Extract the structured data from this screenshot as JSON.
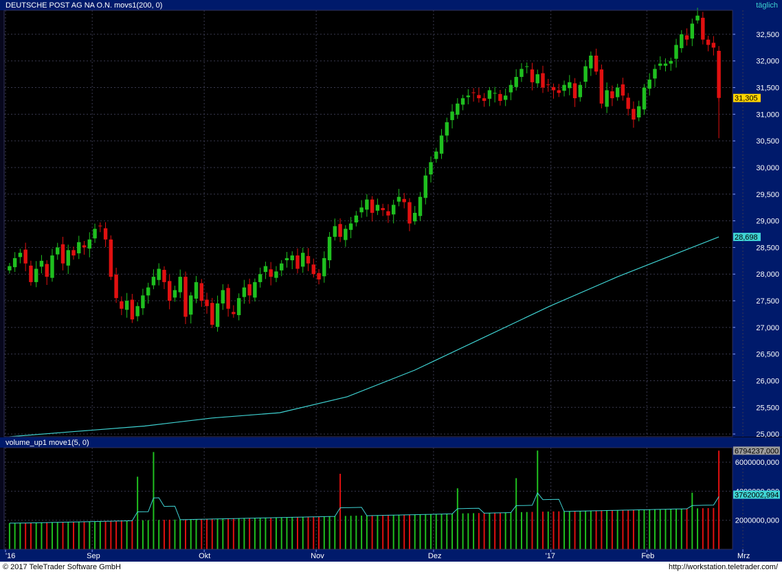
{
  "header": {
    "instrument": "DEUTSCHE POST AG NA O.N.",
    "indicator": "movs1(200, 0)",
    "period": "täglich"
  },
  "volume_header": "volume_up1 move1(5, 0)",
  "footer": {
    "copyright": "© 2017  TeleTrader Software GmbH",
    "url": "http://workstation.teletrader.com/"
  },
  "colors": {
    "background": "#000000",
    "up": "#1fbf1f",
    "down": "#e01010",
    "ma": "#3fd3d3",
    "grid": "#3a3a50",
    "axis_bg": "#001a6b"
  },
  "chart_data": [
    {
      "type": "candlestick",
      "title": "DEUTSCHE POST AG NA O.N.",
      "x_labels": [
        "'16",
        "Sep",
        "Okt",
        "Nov",
        "Dez",
        "'17",
        "Feb",
        "Mrz"
      ],
      "y_ticks": [
        "25,000",
        "25,500",
        "26,000",
        "26,500",
        "27,000",
        "27,500",
        "28,000",
        "28,500",
        "29,000",
        "29,500",
        "30,000",
        "30,500",
        "31,000",
        "31,500",
        "32,000",
        "32,500"
      ],
      "ylim": [
        24950,
        32950
      ],
      "last_price": "31,305",
      "ma_last": "28,698",
      "ma_series": {
        "name": "movs1(200, 0)",
        "x": [
          0,
          20,
          40,
          60,
          80,
          100,
          120,
          140,
          160,
          180,
          200,
          210
        ],
        "values": [
          24950,
          25050,
          25150,
          25300,
          25400,
          25700,
          26200,
          26800,
          27400,
          27950,
          28450,
          28698
        ]
      },
      "closes": [
        28150,
        28300,
        28400,
        28200,
        27850,
        28100,
        28250,
        27950,
        28350,
        28500,
        28200,
        28450,
        28350,
        28600,
        28500,
        28650,
        28850,
        28900,
        28650,
        27950,
        27550,
        27350,
        27500,
        27150,
        27400,
        27600,
        27750,
        27950,
        28100,
        27850,
        27500,
        27700,
        27950,
        27200,
        27600,
        27850,
        27500,
        27400,
        27050,
        27450,
        27700,
        27350,
        27250,
        27550,
        27750,
        27600,
        27850,
        28000,
        28150,
        27950,
        28050,
        28200,
        28300,
        28350,
        28100,
        28400,
        28200,
        28000,
        27900,
        28300,
        28700,
        28900,
        28700,
        28850,
        28950,
        29100,
        29250,
        29400,
        29150,
        29300,
        29200,
        29100,
        29300,
        29450,
        29350,
        28950,
        29150,
        29450,
        29850,
        30100,
        30300,
        30600,
        30850,
        31050,
        31200,
        31300,
        31350,
        31400,
        31300,
        31250,
        31450,
        31400,
        31250,
        31350,
        31550,
        31700,
        31850,
        31900,
        31600,
        31750,
        31500,
        31550,
        31450,
        31400,
        31550,
        31600,
        31300,
        31550,
        31900,
        32100,
        31800,
        31200,
        31450,
        31300,
        31500,
        31350,
        31100,
        30900,
        31150,
        31500,
        31650,
        31850,
        31950,
        31950,
        32000,
        32300,
        32500,
        32400,
        32700,
        32850,
        32400,
        32300,
        32250,
        31305
      ]
    },
    {
      "type": "bar",
      "title": "volume_up1 move1(5, 0)",
      "y_ticks": [
        "2000000,000",
        "4000000,000",
        "6000000,000"
      ],
      "ylim": [
        0,
        7000000
      ],
      "volume_last": "6794237,000",
      "volume_ma_last": "3762002,994"
    }
  ]
}
